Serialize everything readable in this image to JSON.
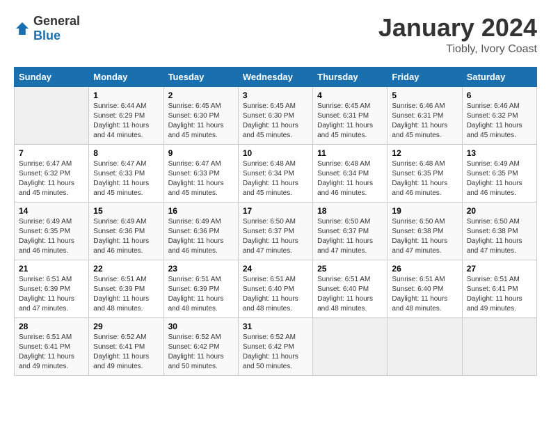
{
  "header": {
    "logo_general": "General",
    "logo_blue": "Blue",
    "month": "January 2024",
    "location": "Tiobly, Ivory Coast"
  },
  "weekdays": [
    "Sunday",
    "Monday",
    "Tuesday",
    "Wednesday",
    "Thursday",
    "Friday",
    "Saturday"
  ],
  "weeks": [
    [
      {
        "day": "",
        "sunrise": "",
        "sunset": "",
        "daylight": ""
      },
      {
        "day": "1",
        "sunrise": "6:44 AM",
        "sunset": "6:29 PM",
        "daylight": "11 hours and 44 minutes."
      },
      {
        "day": "2",
        "sunrise": "6:45 AM",
        "sunset": "6:30 PM",
        "daylight": "11 hours and 45 minutes."
      },
      {
        "day": "3",
        "sunrise": "6:45 AM",
        "sunset": "6:30 PM",
        "daylight": "11 hours and 45 minutes."
      },
      {
        "day": "4",
        "sunrise": "6:45 AM",
        "sunset": "6:31 PM",
        "daylight": "11 hours and 45 minutes."
      },
      {
        "day": "5",
        "sunrise": "6:46 AM",
        "sunset": "6:31 PM",
        "daylight": "11 hours and 45 minutes."
      },
      {
        "day": "6",
        "sunrise": "6:46 AM",
        "sunset": "6:32 PM",
        "daylight": "11 hours and 45 minutes."
      }
    ],
    [
      {
        "day": "7",
        "sunrise": "6:47 AM",
        "sunset": "6:32 PM",
        "daylight": "11 hours and 45 minutes."
      },
      {
        "day": "8",
        "sunrise": "6:47 AM",
        "sunset": "6:33 PM",
        "daylight": "11 hours and 45 minutes."
      },
      {
        "day": "9",
        "sunrise": "6:47 AM",
        "sunset": "6:33 PM",
        "daylight": "11 hours and 45 minutes."
      },
      {
        "day": "10",
        "sunrise": "6:48 AM",
        "sunset": "6:34 PM",
        "daylight": "11 hours and 45 minutes."
      },
      {
        "day": "11",
        "sunrise": "6:48 AM",
        "sunset": "6:34 PM",
        "daylight": "11 hours and 46 minutes."
      },
      {
        "day": "12",
        "sunrise": "6:48 AM",
        "sunset": "6:35 PM",
        "daylight": "11 hours and 46 minutes."
      },
      {
        "day": "13",
        "sunrise": "6:49 AM",
        "sunset": "6:35 PM",
        "daylight": "11 hours and 46 minutes."
      }
    ],
    [
      {
        "day": "14",
        "sunrise": "6:49 AM",
        "sunset": "6:35 PM",
        "daylight": "11 hours and 46 minutes."
      },
      {
        "day": "15",
        "sunrise": "6:49 AM",
        "sunset": "6:36 PM",
        "daylight": "11 hours and 46 minutes."
      },
      {
        "day": "16",
        "sunrise": "6:49 AM",
        "sunset": "6:36 PM",
        "daylight": "11 hours and 46 minutes."
      },
      {
        "day": "17",
        "sunrise": "6:50 AM",
        "sunset": "6:37 PM",
        "daylight": "11 hours and 47 minutes."
      },
      {
        "day": "18",
        "sunrise": "6:50 AM",
        "sunset": "6:37 PM",
        "daylight": "11 hours and 47 minutes."
      },
      {
        "day": "19",
        "sunrise": "6:50 AM",
        "sunset": "6:38 PM",
        "daylight": "11 hours and 47 minutes."
      },
      {
        "day": "20",
        "sunrise": "6:50 AM",
        "sunset": "6:38 PM",
        "daylight": "11 hours and 47 minutes."
      }
    ],
    [
      {
        "day": "21",
        "sunrise": "6:51 AM",
        "sunset": "6:39 PM",
        "daylight": "11 hours and 47 minutes."
      },
      {
        "day": "22",
        "sunrise": "6:51 AM",
        "sunset": "6:39 PM",
        "daylight": "11 hours and 48 minutes."
      },
      {
        "day": "23",
        "sunrise": "6:51 AM",
        "sunset": "6:39 PM",
        "daylight": "11 hours and 48 minutes."
      },
      {
        "day": "24",
        "sunrise": "6:51 AM",
        "sunset": "6:40 PM",
        "daylight": "11 hours and 48 minutes."
      },
      {
        "day": "25",
        "sunrise": "6:51 AM",
        "sunset": "6:40 PM",
        "daylight": "11 hours and 48 minutes."
      },
      {
        "day": "26",
        "sunrise": "6:51 AM",
        "sunset": "6:40 PM",
        "daylight": "11 hours and 48 minutes."
      },
      {
        "day": "27",
        "sunrise": "6:51 AM",
        "sunset": "6:41 PM",
        "daylight": "11 hours and 49 minutes."
      }
    ],
    [
      {
        "day": "28",
        "sunrise": "6:51 AM",
        "sunset": "6:41 PM",
        "daylight": "11 hours and 49 minutes."
      },
      {
        "day": "29",
        "sunrise": "6:52 AM",
        "sunset": "6:41 PM",
        "daylight": "11 hours and 49 minutes."
      },
      {
        "day": "30",
        "sunrise": "6:52 AM",
        "sunset": "6:42 PM",
        "daylight": "11 hours and 50 minutes."
      },
      {
        "day": "31",
        "sunrise": "6:52 AM",
        "sunset": "6:42 PM",
        "daylight": "11 hours and 50 minutes."
      },
      {
        "day": "",
        "sunrise": "",
        "sunset": "",
        "daylight": ""
      },
      {
        "day": "",
        "sunrise": "",
        "sunset": "",
        "daylight": ""
      },
      {
        "day": "",
        "sunrise": "",
        "sunset": "",
        "daylight": ""
      }
    ]
  ]
}
